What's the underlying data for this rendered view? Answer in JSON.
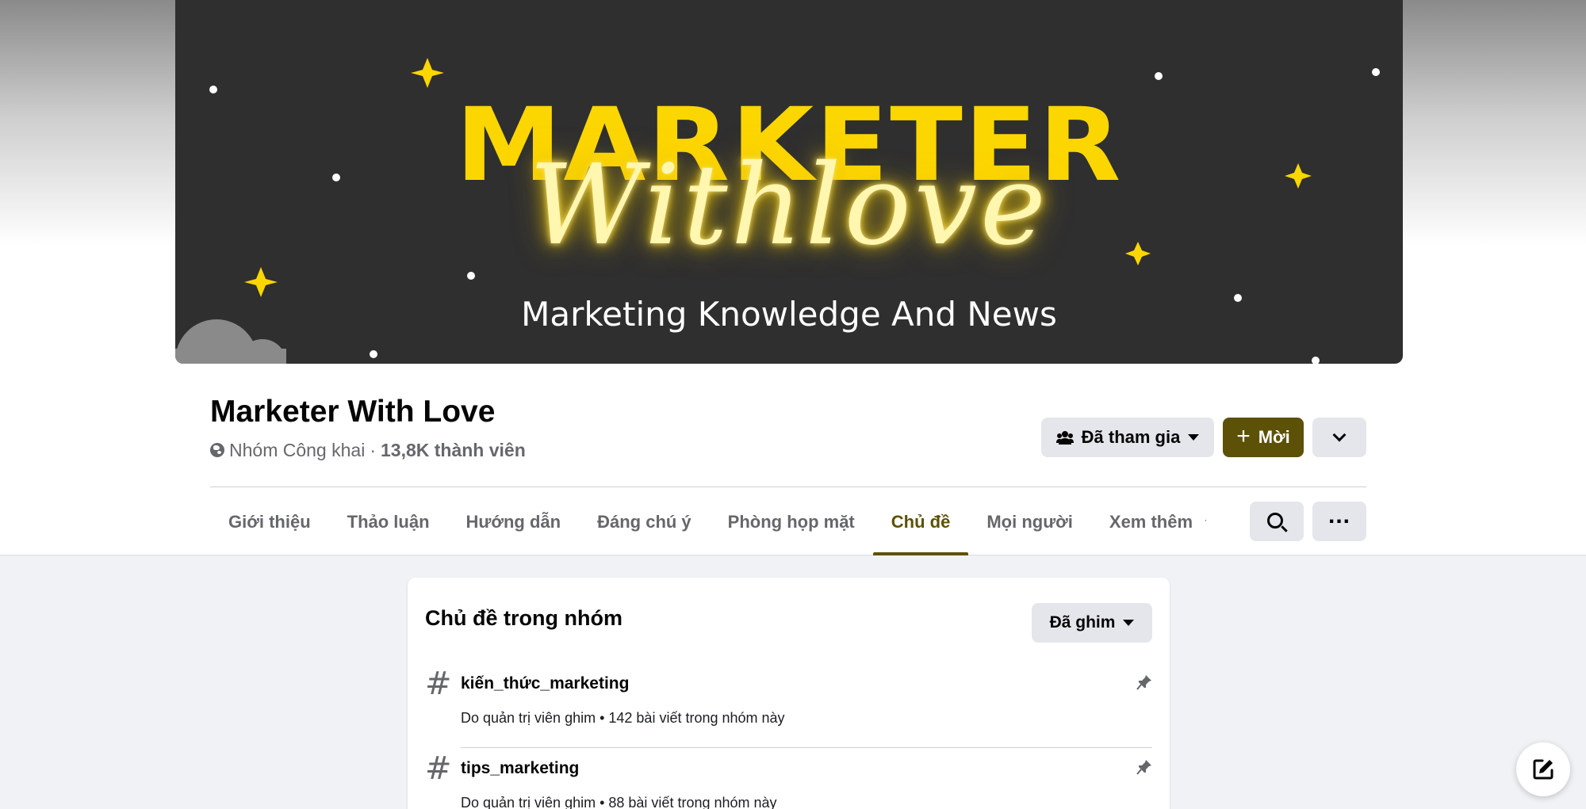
{
  "cover": {
    "title": "MARKETER",
    "script": "Withlove",
    "subtitle": "Marketing Knowledge And News",
    "colors": {
      "background": "#2f2f2f",
      "accent": "#fcd600"
    }
  },
  "group": {
    "name": "Marketer With Love",
    "privacy": "Nhóm Công khai",
    "separator": "·",
    "members": "13,8K thành viên"
  },
  "actions": {
    "joined_label": "Đã tham gia",
    "invite_label": "Mời",
    "expand_icon": "chevron-down-icon"
  },
  "tabs": [
    {
      "label": "Giới thiệu",
      "active": false
    },
    {
      "label": "Thảo luận",
      "active": false
    },
    {
      "label": "Hướng dẫn",
      "active": false
    },
    {
      "label": "Đáng chú ý",
      "active": false
    },
    {
      "label": "Phòng họp mặt",
      "active": false
    },
    {
      "label": "Chủ đề",
      "active": true
    },
    {
      "label": "Mọi người",
      "active": false
    },
    {
      "label": "Xem thêm",
      "active": false
    }
  ],
  "topics_card": {
    "title": "Chủ đề trong nhóm",
    "filter_label": "Đã ghim",
    "items": [
      {
        "hash": "#",
        "name": "kiến_thức_marketing",
        "meta": "Do quản trị viên ghim • 142 bài viết trong nhóm này"
      },
      {
        "hash": "#",
        "name": "tips_marketing",
        "meta": "Do quản trị viên ghim • 88 bài viết trong nhóm này"
      }
    ]
  },
  "theme": {
    "brand": "#5c5106",
    "page_bg": "#f0f2f5"
  }
}
